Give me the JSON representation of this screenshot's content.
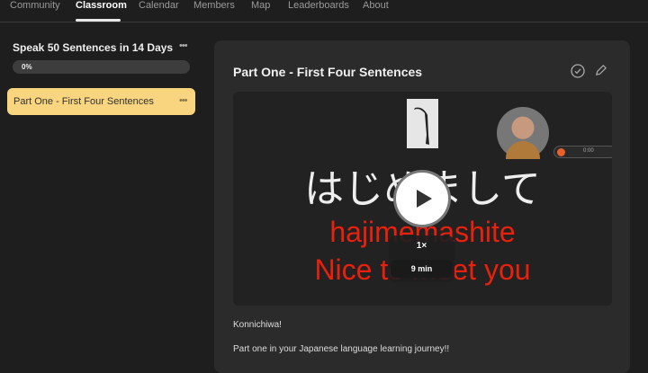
{
  "nav": {
    "tabs": [
      "Community",
      "Classroom",
      "Calendar",
      "Members",
      "Map",
      "Leaderboards",
      "About"
    ],
    "active": "Classroom"
  },
  "sidebar": {
    "course_title": "Speak 50 Sentences in 14 Days",
    "progress_label": "0%",
    "progress": 0,
    "items": [
      {
        "label": "Part One - First Four Sentences",
        "active": true
      }
    ]
  },
  "lesson": {
    "title": "Part One - First Four Sentences",
    "video": {
      "japanese": "はじめまして",
      "romaji": "hajimemashite",
      "english": "Nice to meet you",
      "speed": "1×",
      "duration": "9 min",
      "recorder_time": "0:00"
    },
    "body": [
      "Konnichiwa!",
      "Part one in your Japanese language learning journey!!"
    ]
  },
  "colors": {
    "accent": "#f8d57e",
    "subtitle_red": "#e8200c",
    "background": "#1e1e1e",
    "card": "#2b2b2b"
  }
}
